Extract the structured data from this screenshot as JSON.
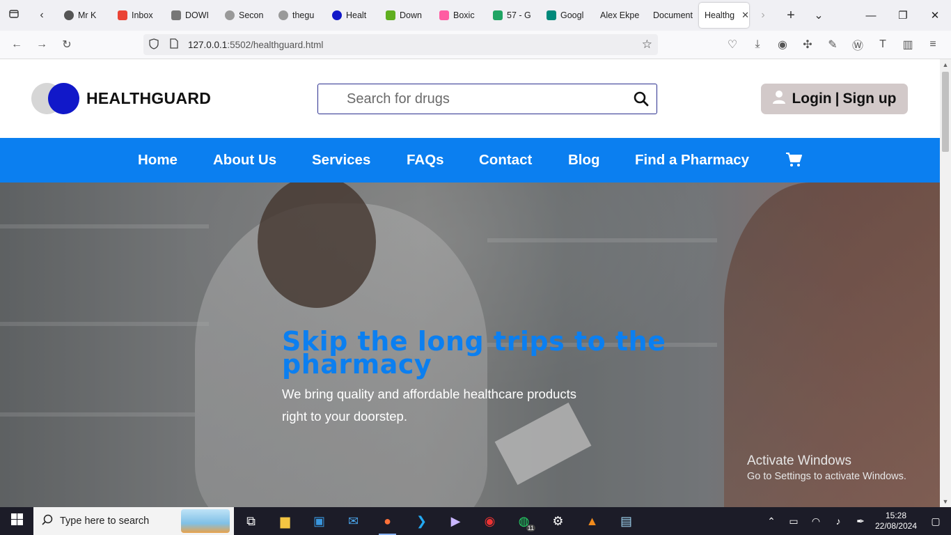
{
  "browser": {
    "tabs": [
      {
        "label": "Mr K",
        "icon": "info-circle-icon",
        "color": "#555555"
      },
      {
        "label": "Inbox",
        "icon": "gmail-icon",
        "color": "#ea4335"
      },
      {
        "label": "DOWI",
        "icon": "download-page-icon",
        "color": "#777777"
      },
      {
        "label": "Secon",
        "icon": "github-icon",
        "color": "#999999"
      },
      {
        "label": "thegu",
        "icon": "github-icon",
        "color": "#999999"
      },
      {
        "label": "Healt",
        "icon": "healthguard-icon",
        "color": "#1118c9"
      },
      {
        "label": "Down",
        "icon": "download-arrow-icon",
        "color": "#5fae1f"
      },
      {
        "label": "Boxic",
        "icon": "boxicons-icon",
        "color": "#ff5da2"
      },
      {
        "label": "57 - G",
        "icon": "google-drive-icon",
        "color": "#1fa463"
      },
      {
        "label": "Googl",
        "icon": "google-meet-icon",
        "color": "#00897b"
      },
      {
        "label": "Alex Ekpe",
        "icon": "",
        "color": ""
      },
      {
        "label": "Document",
        "icon": "",
        "color": ""
      }
    ],
    "active_tab": {
      "label": "Healthg",
      "icon": "",
      "color": ""
    },
    "url_host": "127.0.0.1",
    "url_rest": ":5502/healthguard.html"
  },
  "site": {
    "brand": "HEALTHGUARD",
    "search_placeholder": "Search for drugs",
    "login_label": "Login",
    "separator": "|",
    "signup_label": "Sign up",
    "nav": [
      "Home",
      "About Us",
      "Services",
      "FAQs",
      "Contact",
      "Blog",
      "Find a Pharmacy"
    ],
    "colors": {
      "nav_bg": "#0b7ff0",
      "brand_circle": "#1118c9",
      "login_bg": "#d2c9c9",
      "hero_title": "#0b7ff0"
    }
  },
  "hero": {
    "title": "Skip the long trips to the pharmacy",
    "subtitle": "We bring quality and affordable healthcare products right to your doorstep."
  },
  "watermark": {
    "line1": "Activate Windows",
    "line2": "Go to Settings to activate Windows."
  },
  "taskbar": {
    "search_placeholder": "Type here to search",
    "whatsapp_badge": "11",
    "time": "15:28",
    "date": "22/08/2024"
  }
}
